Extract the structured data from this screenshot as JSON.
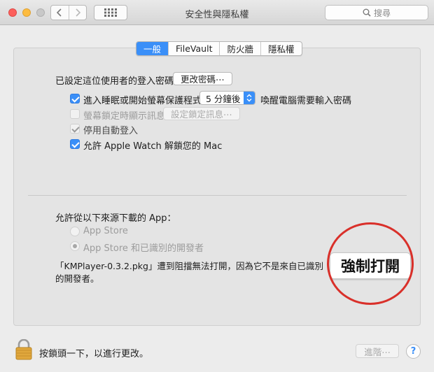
{
  "window": {
    "title": "安全性與隱私權"
  },
  "search": {
    "placeholder": "搜尋"
  },
  "tabs": [
    {
      "label": "一般",
      "active": true
    },
    {
      "label": "FileVault",
      "active": false
    },
    {
      "label": "防火牆",
      "active": false
    },
    {
      "label": "隱私權",
      "active": false
    }
  ],
  "general": {
    "password_label": "已設定這位使用者的登入密碼",
    "change_password_button": "更改密碼⋯",
    "require_password_label": "進入睡眠或開始螢幕保護程式",
    "require_password_delay": "5 分鐘後",
    "require_password_suffix": "喚醒電腦需要輸入密碼",
    "show_message_label": "螢幕鎖定時顯示訊息",
    "set_message_button": "設定鎖定訊息⋯",
    "disable_autologin_label": "停用自動登入",
    "apple_watch_label": "允許 Apple Watch 解鎖您的 Mac"
  },
  "downloads": {
    "heading": "允許從以下來源下載的 App：",
    "option_app_store": "App Store",
    "option_identified": "App Store 和已識別的開發者",
    "notice": "「KMPlayer-0.3.2.pkg」遭到阻擋無法打開，因為它不是來自已識別的開發者。",
    "open_anyway_button": "強制打開"
  },
  "footer": {
    "lock_text": "按鎖頭一下，以進行更改。",
    "advanced_button": "進階⋯",
    "help_button": "?"
  },
  "colors": {
    "accent": "#3a8ff8",
    "highlight_circle": "#d9302a"
  }
}
